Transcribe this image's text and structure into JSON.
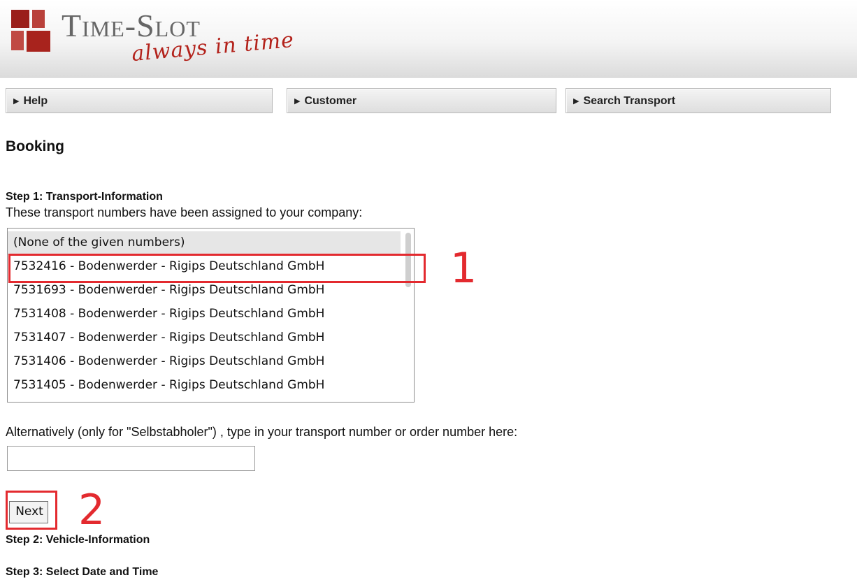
{
  "header": {
    "logo_title": "Time-Slot",
    "logo_tagline": "always in time"
  },
  "nav": {
    "help": "Help",
    "customer": "Customer",
    "search_transport": "Search Transport"
  },
  "page": {
    "title": "Booking"
  },
  "step1": {
    "title": "Step 1: Transport-Information",
    "description": "These transport numbers have been assigned to your company:",
    "options": [
      "(None of the given numbers)",
      "7532416 - Bodenwerder - Rigips Deutschland GmbH",
      "7531693 - Bodenwerder - Rigips Deutschland GmbH",
      "7531408 - Bodenwerder - Rigips Deutschland GmbH",
      "7531407 - Bodenwerder - Rigips Deutschland GmbH",
      "7531406 - Bodenwerder - Rigips Deutschland GmbH",
      "7531405 - Bodenwerder - Rigips Deutschland GmbH"
    ],
    "selected_option": "(None of the given numbers)"
  },
  "alternative": {
    "label": "Alternatively (only for \"Selbstabholer\") , type in your transport number or order number here:",
    "value": ""
  },
  "next_button": "Next",
  "step2": {
    "title": "Step 2: Vehicle-Information"
  },
  "step3": {
    "title": "Step 3: Select Date and Time"
  },
  "annotations": {
    "marker1": "1",
    "marker2": "2"
  },
  "colors": {
    "annotation": "#e32a2f",
    "logo_red": "#a8231d",
    "nav_bg": "#e8e8e8"
  }
}
